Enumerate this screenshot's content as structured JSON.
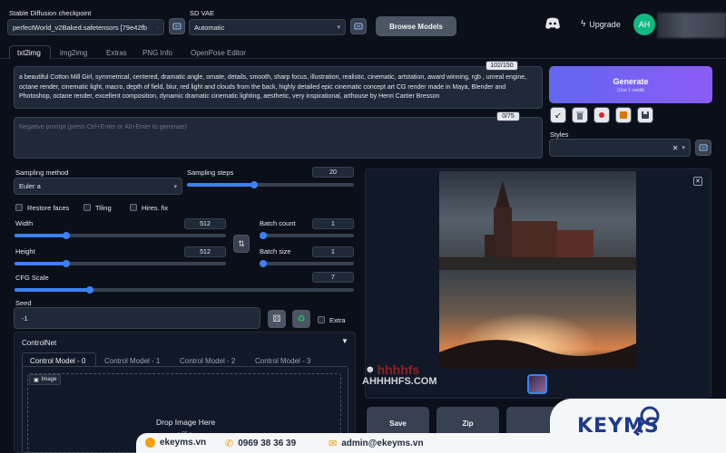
{
  "topbar": {
    "checkpoint_label": "Stable Diffusion checkpoint",
    "checkpoint_value": "perfectWorld_v2Baked.safetensors [79e42fb",
    "vae_label": "SD VAE",
    "vae_value": "Automatic",
    "browse_button": "Browse Models",
    "upgrade_button": "Upgrade",
    "avatar_initials": "AH"
  },
  "tabs": [
    "txt2img",
    "img2img",
    "Extras",
    "PNG Info",
    "OpenPose Editor"
  ],
  "prompt": {
    "text": "a beautiful Cotton Mill Girl, symmetrical, centered, dramatic angle, ornate, details, smooth, sharp focus, illustration, realistic, cinematic, artstation, award winning, rgb , unreal engine, octane render, cinematic light, macro, depth of field, blur, red light and clouds from the back, highly detailed epic cinematic concept art CG render made in Maya, Blender and Photoshop, octane render, excellent composition, dynamic dramatic cinematic lighting, aesthetic, very inspirational, arthouse by Henri Cartier Bresson",
    "token_count": "102/150",
    "negative_placeholder": "Negative prompt (press Ctrl+Enter or Alt+Enter to generate)",
    "negative_count": "0/75"
  },
  "generate": {
    "label": "Generate",
    "sub": "(Use 1 credit)",
    "styles_label": "Styles"
  },
  "params": {
    "sampling_method_label": "Sampling method",
    "sampling_method_value": "Euler a",
    "sampling_steps_label": "Sampling steps",
    "sampling_steps_value": "20",
    "restore_faces": "Restore faces",
    "tiling": "Tiling",
    "hires_fix": "Hires. fix",
    "width_label": "Width",
    "width_value": "512",
    "height_label": "Height",
    "height_value": "512",
    "batch_count_label": "Batch count",
    "batch_count_value": "1",
    "batch_size_label": "Batch size",
    "batch_size_value": "1",
    "cfg_label": "CFG Scale",
    "cfg_value": "7",
    "seed_label": "Seed",
    "seed_value": "-1",
    "extra_label": "Extra"
  },
  "controlnet": {
    "title": "ControlNet",
    "tabs": [
      "Control Model - 0",
      "Control Model - 1",
      "Control Model - 2",
      "Control Model - 3"
    ],
    "image_label": "Image",
    "drop_text": "Drop Image Here",
    "or_text": "- or -"
  },
  "output": {
    "save_button": "Save",
    "zip_button": "Zip"
  },
  "watermark": {
    "site": "AHHHHFS.COM",
    "logo_text": "hhhhfs"
  },
  "footer": {
    "website": "ekeyms.vn",
    "phone": "0969 38 36 39",
    "email": "admin@ekeyms.vn",
    "brand": "KEYMS"
  },
  "colors": {
    "generate_gradient": [
      "#6366f1",
      "#8b5cf6"
    ],
    "accent_blue": "#3b82f6",
    "avatar_green": "#10b981",
    "footer_bg": "#f5f6f8"
  }
}
